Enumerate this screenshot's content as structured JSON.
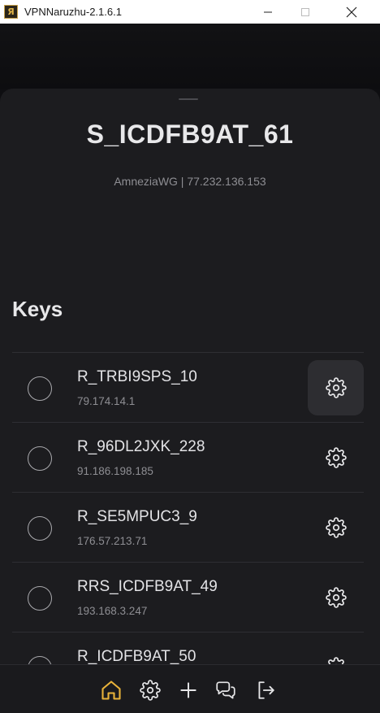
{
  "window": {
    "title": "VPNNaruzhu-2.1.6.1",
    "app_icon_letter": "Я"
  },
  "server": {
    "name": "S_ICDFB9AT_61",
    "info": "AmneziaWG | 77.232.136.153"
  },
  "keys": {
    "heading": "Keys",
    "items": [
      {
        "name": "R_TRBI9SPS_10",
        "ip": "79.174.14.1",
        "selected": false,
        "settings_active": true
      },
      {
        "name": "R_96DL2JXK_228",
        "ip": "91.186.198.185",
        "selected": false,
        "settings_active": false
      },
      {
        "name": "R_SE5MPUC3_9",
        "ip": "176.57.213.71",
        "selected": false,
        "settings_active": false
      },
      {
        "name": "RRS_ICDFB9AT_49",
        "ip": "193.168.3.247",
        "selected": false,
        "settings_active": false
      },
      {
        "name": "R_ICDFB9AT_50",
        "ip": "",
        "selected": false,
        "settings_active": false
      }
    ]
  },
  "nav": {
    "items": [
      "home-icon",
      "gear-icon",
      "plus-icon",
      "chat-icon",
      "logout-icon"
    ],
    "active": "home-icon"
  },
  "colors": {
    "accent": "#e8b23a",
    "sheet_bg": "#1c1c1f",
    "text_primary": "#e3e3e6",
    "text_secondary": "#8e8e93"
  }
}
